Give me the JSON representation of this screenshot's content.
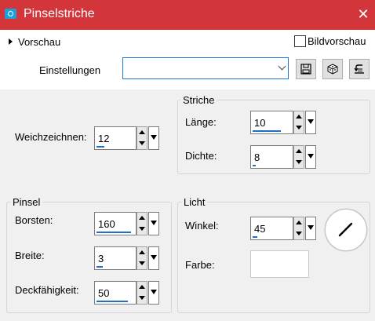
{
  "window": {
    "title": "Pinselstriche",
    "close_glyph": "✕"
  },
  "header": {
    "preview_label": "Vorschau",
    "big_preview_label": "Bildvorschau",
    "big_preview_checked": false,
    "settings_label": "Einstellungen",
    "settings_value": "",
    "icons": [
      "save-icon",
      "dice-icon",
      "reset-icon"
    ]
  },
  "main": {
    "softness": {
      "label": "Weichzeichnen:",
      "value": "12"
    },
    "strokes": {
      "title": "Striche",
      "length": {
        "label": "Länge:",
        "value": "10"
      },
      "density": {
        "label": "Dichte:",
        "value": "8"
      }
    },
    "brush": {
      "title": "Pinsel",
      "bristles": {
        "label": "Borsten:",
        "value": "160"
      },
      "width": {
        "label": "Breite:",
        "value": "3"
      },
      "opacity": {
        "label": "Deckfähigkeit:",
        "value": "50"
      }
    },
    "light": {
      "title": "Licht",
      "angle": {
        "label": "Winkel:",
        "value": "45"
      },
      "color": {
        "label": "Farbe:",
        "value": "#ffffff"
      }
    }
  },
  "colors": {
    "titlebar": "#d2363b",
    "accent": "#1d79cc",
    "background": "#f0f0f0"
  }
}
